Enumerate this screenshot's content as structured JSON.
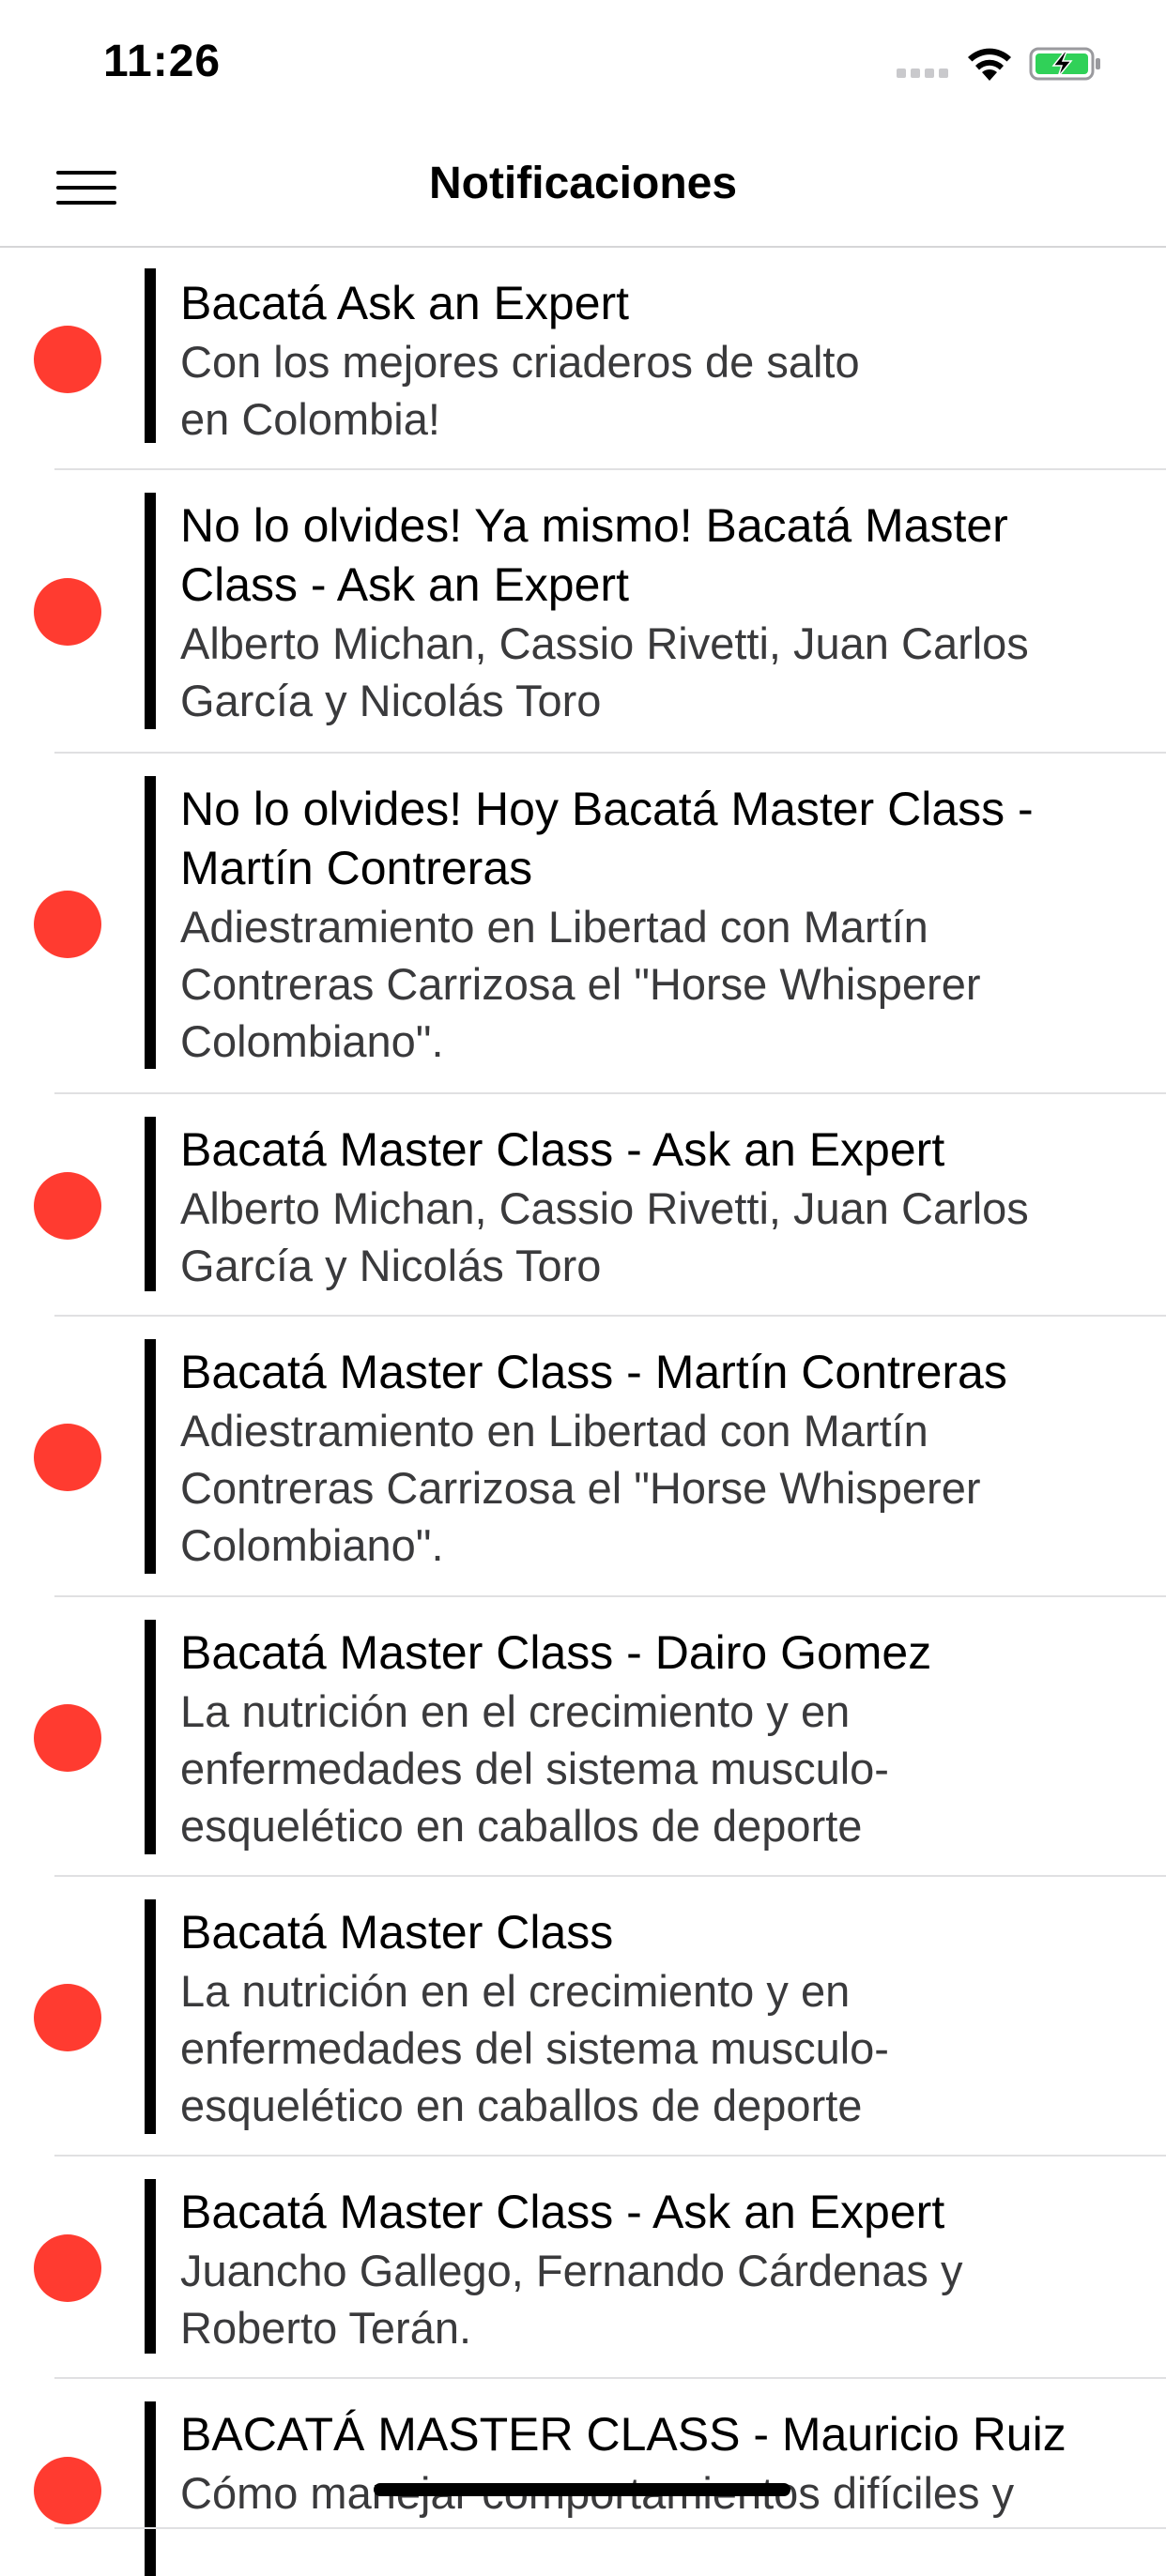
{
  "status_bar": {
    "time": "11:26"
  },
  "nav": {
    "title": "Notificaciones",
    "menu_icon": "hamburger-menu-icon"
  },
  "colors": {
    "unread_dot": "#ff3b30",
    "accent_bar": "#000000"
  },
  "notifications": [
    {
      "title": "Bacatá Ask an Expert",
      "body": "Con los mejores criaderos de salto\nen Colombia!"
    },
    {
      "title": "No lo olvides! Ya mismo! Bacatá Master\nClass - Ask an Expert",
      "body": "Alberto Michan, Cassio Rivetti, Juan Carlos\nGarcía y Nicolás Toro"
    },
    {
      "title": "No lo olvides! Hoy Bacatá Master Class -\nMartín Contreras",
      "body": "Adiestramiento en Libertad con Martín\nContreras Carrizosa el \"Horse Whisperer\nColombiano\"."
    },
    {
      "title": "Bacatá Master Class - Ask an Expert",
      "body": "Alberto Michan, Cassio Rivetti, Juan Carlos\nGarcía y Nicolás Toro"
    },
    {
      "title": "Bacatá Master Class - Martín Contreras",
      "body": "Adiestramiento en Libertad con Martín\nContreras Carrizosa el \"Horse Whisperer\nColombiano\"."
    },
    {
      "title": "Bacatá Master Class - Dairo Gomez",
      "body": "La nutrición en el crecimiento y en\nenfermedades del sistema musculo-\nesquelético en caballos de deporte"
    },
    {
      "title": "Bacatá Master Class",
      "body": "La nutrición en el crecimiento y en\nenfermedades del sistema musculo-\nesquelético en caballos de deporte"
    },
    {
      "title": "Bacatá Master Class - Ask an Expert",
      "body": "Juancho Gallego, Fernando Cárdenas y\nRoberto Terán."
    },
    {
      "title": "BACATÁ MASTER CLASS - Mauricio Ruiz",
      "body": "Cómo manejar comportamientos difíciles y"
    }
  ]
}
